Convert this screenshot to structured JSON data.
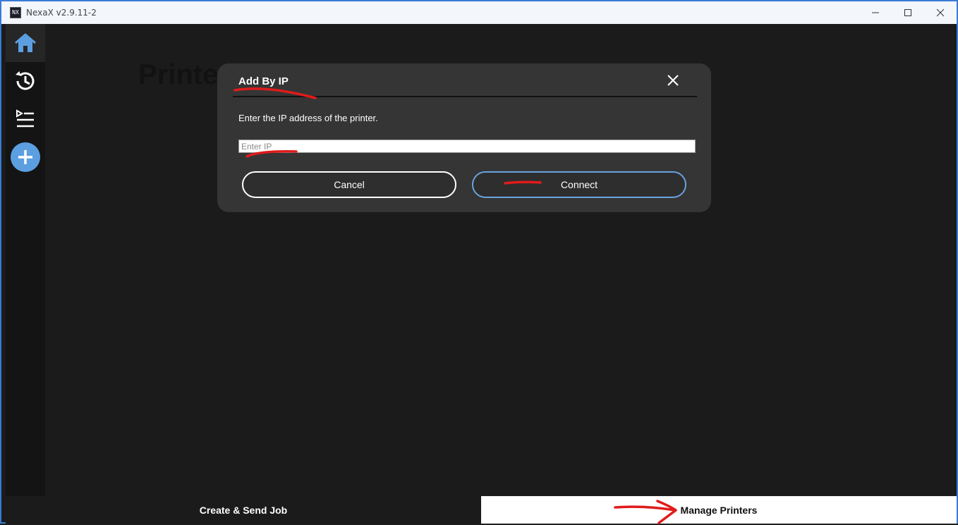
{
  "window": {
    "title": "NexaX v2.9.11-2",
    "icon_label": "NX"
  },
  "sidebar": {
    "items": [
      {
        "name": "home",
        "icon": "home-icon",
        "active": true
      },
      {
        "name": "history",
        "icon": "history-icon",
        "active": false
      },
      {
        "name": "queue",
        "icon": "queue-list-icon",
        "active": false
      },
      {
        "name": "add",
        "icon": "add-circle-icon",
        "active": false
      }
    ]
  },
  "main": {
    "background_title": "Printe"
  },
  "modal": {
    "title": "Add By IP",
    "description": "Enter the IP address of the printer.",
    "input_placeholder": "Enter IP",
    "input_value": "",
    "cancel_label": "Cancel",
    "connect_label": "Connect"
  },
  "bottombar": {
    "left_label": "Create & Send Job",
    "right_label": "Manage Printers"
  },
  "colors": {
    "accent": "#5b9fe0",
    "annotation": "#e01b1b"
  }
}
